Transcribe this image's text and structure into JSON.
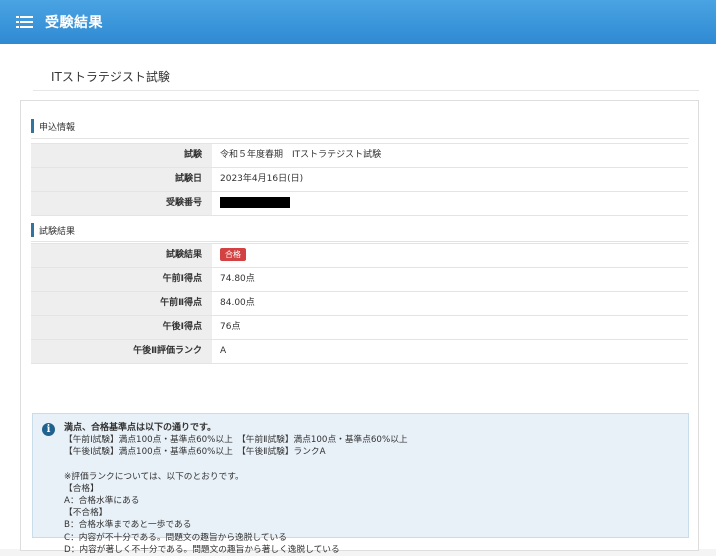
{
  "header": {
    "title": "受験結果",
    "menu_icon": "list-icon"
  },
  "exam": {
    "title": "ITストラテジスト試験"
  },
  "application_info": {
    "heading": "申込情報",
    "rows": [
      {
        "label": "試験",
        "value": "令和５年度春期　ITストラテジスト試験"
      },
      {
        "label": "試験日",
        "value": "2023年4月16日(日)"
      },
      {
        "label": "受験番号",
        "value": ""
      }
    ]
  },
  "exam_results": {
    "heading": "試験結果",
    "rows": [
      {
        "label": "試験結果",
        "value": "合格"
      },
      {
        "label": "午前Ⅰ得点",
        "value": "74.80点"
      },
      {
        "label": "午前Ⅱ得点",
        "value": "84.00点"
      },
      {
        "label": "午後Ⅰ得点",
        "value": "76点"
      },
      {
        "label": "午後Ⅱ評価ランク",
        "value": "A"
      }
    ],
    "pass_badge_color": "#d24242"
  },
  "info": {
    "icon": "info-circle-icon",
    "title": "満点、合格基準点は以下の通りです。",
    "line1": "【午前Ⅰ試験】満点100点・基準点60%以上　【午前Ⅱ試験】満点100点・基準点60%以上",
    "line2": "【午後Ⅰ試験】満点100点・基準点60%以上　【午後Ⅱ試験】ランクA",
    "note": "※評価ランクについては、以下のとおりです。",
    "pass_heading": "【合格】",
    "rank_a": "A：合格水準にある",
    "fail_heading": "【不合格】",
    "rank_b": "B：合格水準まであと一歩である",
    "rank_c": "C：内容が不十分である。問題文の趣旨から逸脱している",
    "rank_d": "D：内容が著しく不十分である。問題文の趣旨から著しく逸脱している"
  },
  "colors": {
    "header": "#3a97dc",
    "section_marker": "#32739f",
    "info_background": "#e8f1f8"
  }
}
